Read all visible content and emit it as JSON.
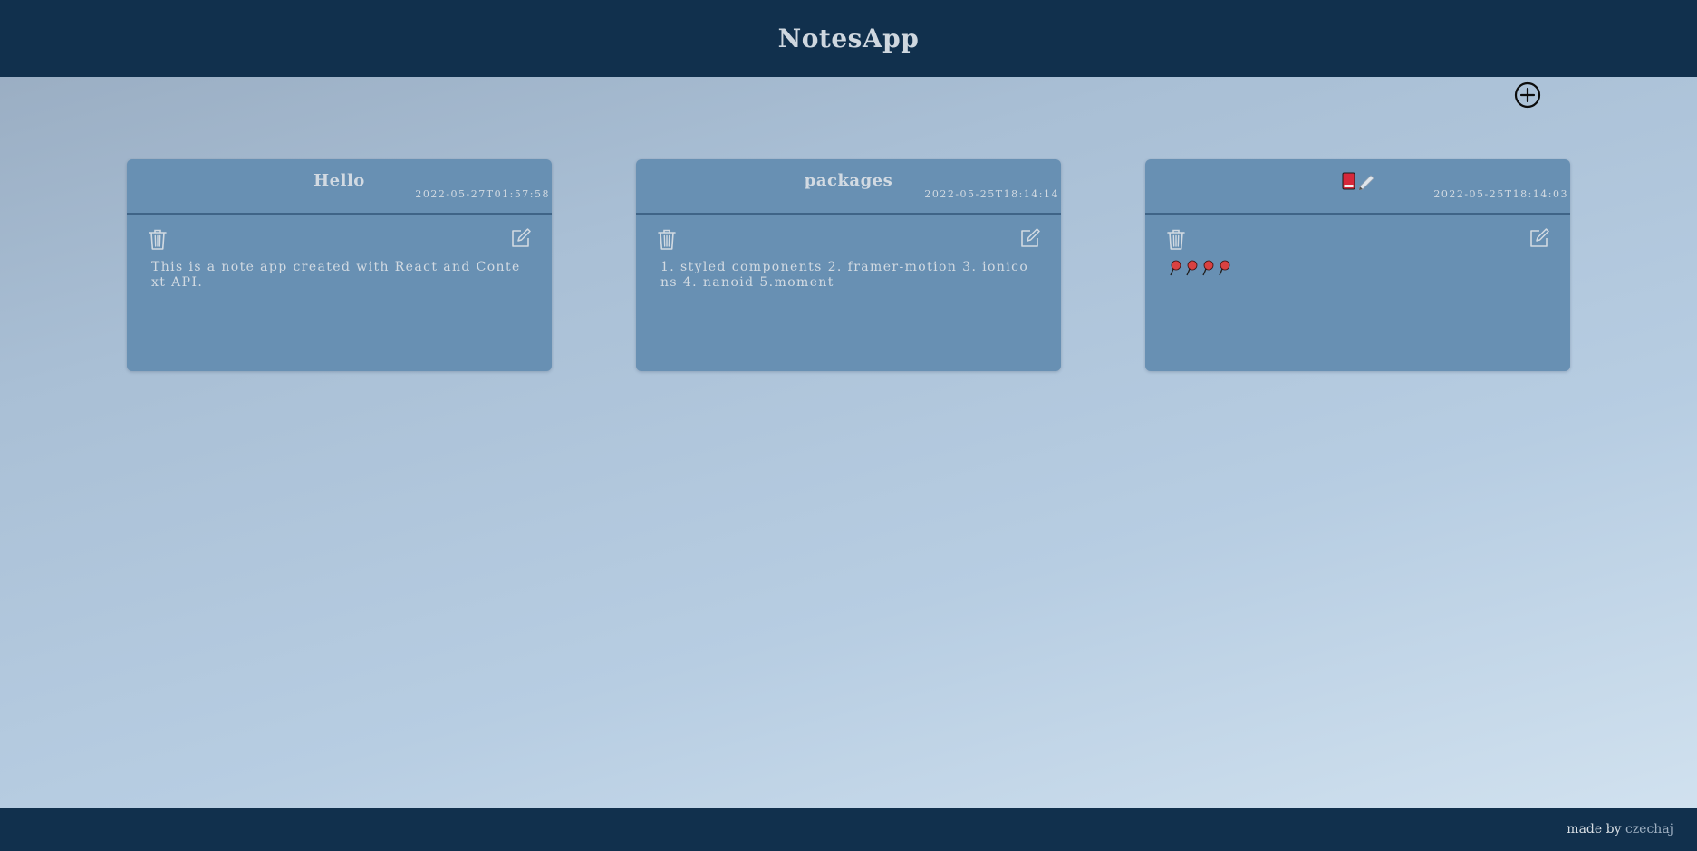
{
  "header": {
    "title": "NotesApp"
  },
  "toolbar": {
    "add_icon": "add-circle-icon"
  },
  "notes": [
    {
      "title": "Hello",
      "date": "2022-05-27T01:57:58",
      "body": "This is a note app created with React and Context API."
    },
    {
      "title": "packages",
      "date": "2022-05-25T18:14:14",
      "body": "1. styled components 2. framer-motion 3. ionicons 4. nanoid 5.moment"
    },
    {
      "title_icons": [
        "red-book-emoji",
        "pencil-emoji"
      ],
      "date": "2022-05-25T18:14:03",
      "body_icons": [
        "pushpin-emoji",
        "pushpin-emoji",
        "pushpin-emoji",
        "pushpin-emoji"
      ]
    }
  ],
  "footer": {
    "prefix": "made by",
    "author": "czechaj"
  },
  "colors": {
    "header_bg": "#11304d",
    "card_bg": "#6890b3",
    "text_light": "#d2dae2"
  }
}
